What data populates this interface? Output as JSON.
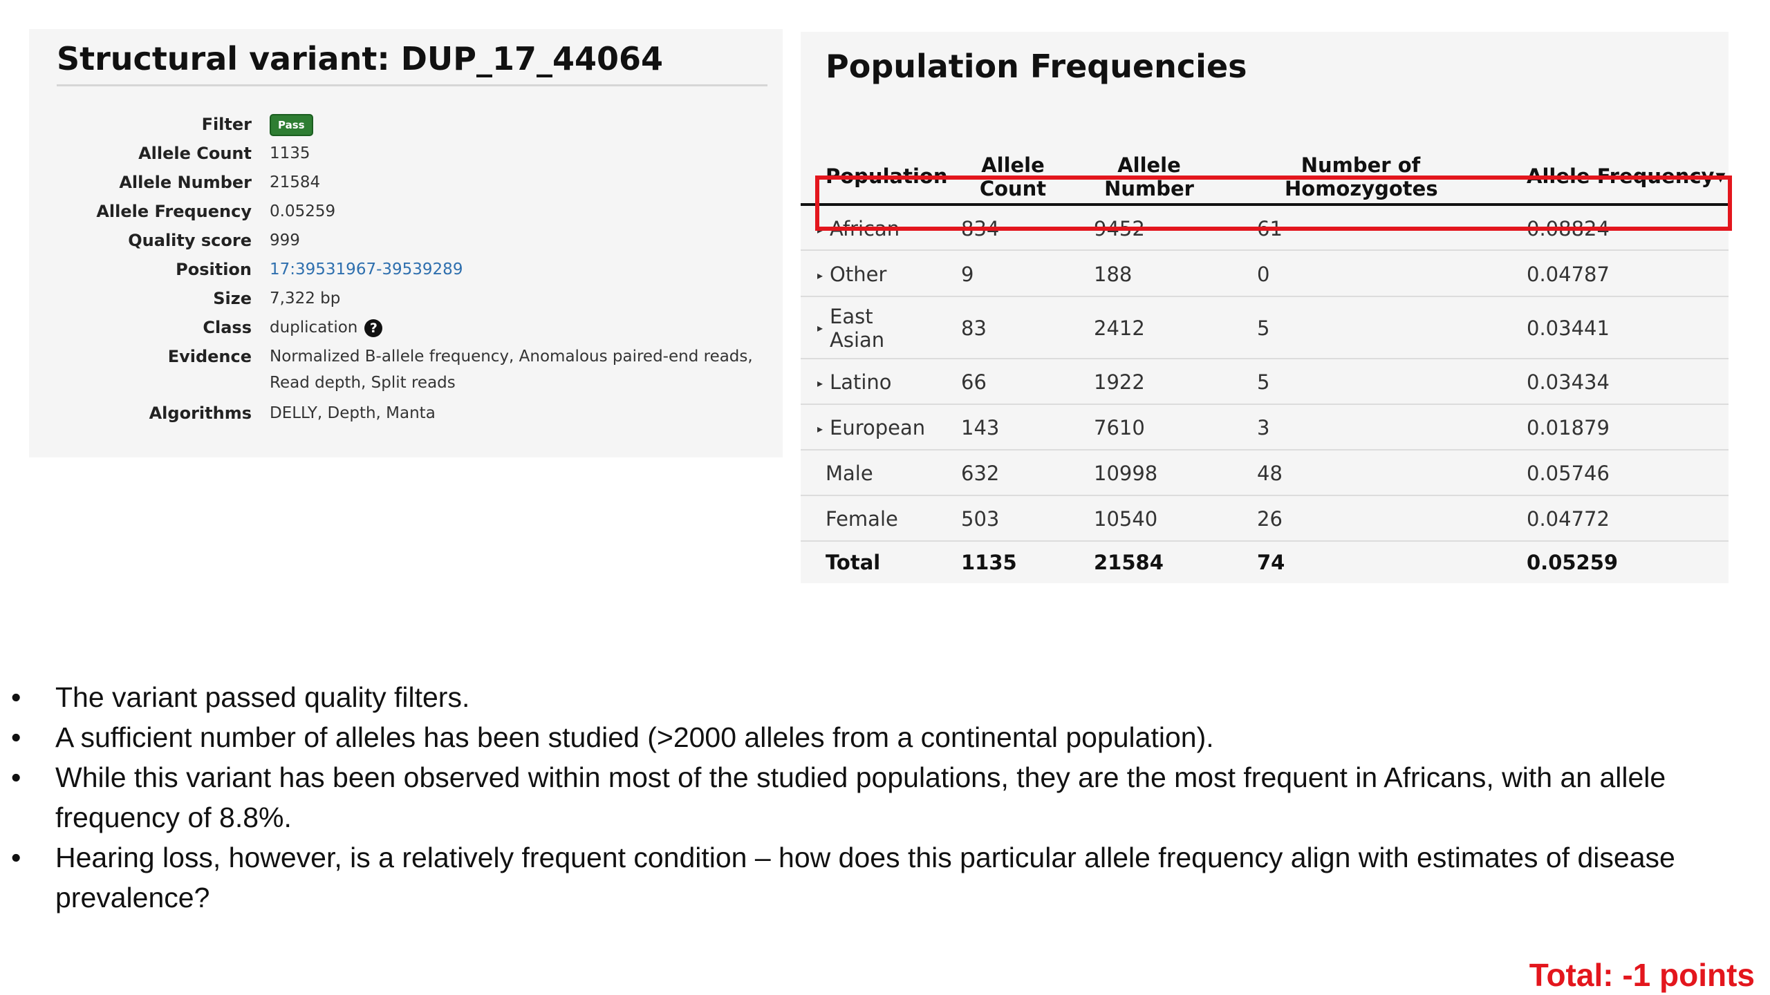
{
  "variant": {
    "title": "Structural variant: DUP_17_44064",
    "fields": {
      "filter_label": "Filter",
      "filter_badge": "Pass",
      "allele_count_label": "Allele Count",
      "allele_count": "1135",
      "allele_number_label": "Allele Number",
      "allele_number": "21584",
      "allele_frequency_label": "Allele Frequency",
      "allele_frequency": "0.05259",
      "quality_label": "Quality score",
      "quality": "999",
      "position_label": "Position",
      "position": "17:39531967-39539289",
      "size_label": "Size",
      "size": "7,322 bp",
      "class_label": "Class",
      "class": "duplication",
      "evidence_label": "Evidence",
      "evidence": "Normalized B-allele frequency, Anomalous paired-end reads, Read depth, Split reads",
      "algorithms_label": "Algorithms",
      "algorithms": "DELLY, Depth, Manta"
    }
  },
  "population_frequencies": {
    "title": "Population Frequencies",
    "headers": {
      "population": "Population",
      "allele_count": "Allele Count",
      "allele_number": "Allele Number",
      "homozygotes": "Number of Homozygotes",
      "allele_frequency": "Allele Frequency"
    },
    "sort_icon": "sort-down-icon",
    "rows": [
      {
        "population": "African",
        "allele_count": "834",
        "allele_number": "9452",
        "homozygotes": "61",
        "allele_frequency": "0.08824",
        "expandable": true,
        "highlighted": true
      },
      {
        "population": "Other",
        "allele_count": "9",
        "allele_number": "188",
        "homozygotes": "0",
        "allele_frequency": "0.04787",
        "expandable": true
      },
      {
        "population": "East Asian",
        "allele_count": "83",
        "allele_number": "2412",
        "homozygotes": "5",
        "allele_frequency": "0.03441",
        "expandable": true
      },
      {
        "population": "Latino",
        "allele_count": "66",
        "allele_number": "1922",
        "homozygotes": "5",
        "allele_frequency": "0.03434",
        "expandable": true
      },
      {
        "population": "European",
        "allele_count": "143",
        "allele_number": "7610",
        "homozygotes": "3",
        "allele_frequency": "0.01879",
        "expandable": true
      },
      {
        "population": "Male",
        "allele_count": "632",
        "allele_number": "10998",
        "homozygotes": "48",
        "allele_frequency": "0.05746",
        "expandable": false
      },
      {
        "population": "Female",
        "allele_count": "503",
        "allele_number": "10540",
        "homozygotes": "26",
        "allele_frequency": "0.04772",
        "expandable": false
      },
      {
        "population": "Total",
        "allele_count": "1135",
        "allele_number": "21584",
        "homozygotes": "74",
        "allele_frequency": "0.05259",
        "expandable": false
      }
    ],
    "highlight_color": "#e3161d"
  },
  "bullets": {
    "marker": "•",
    "items": [
      "The variant passed quality filters.",
      "A sufficient number of alleles has been studied (>2000 alleles from a continental population).",
      "While this variant has been observed within most of the studied populations, they are the most frequent in Africans, with an allele frequency of 8.8%.",
      "Hearing loss, however, is a relatively frequent condition – how does this particular allele frequency align with estimates of disease prevalence?"
    ]
  },
  "total_note": "Total: -1 points",
  "colors": {
    "badge": "#2e7d32",
    "link": "#2e6fae",
    "accent_red": "#e3161d"
  }
}
